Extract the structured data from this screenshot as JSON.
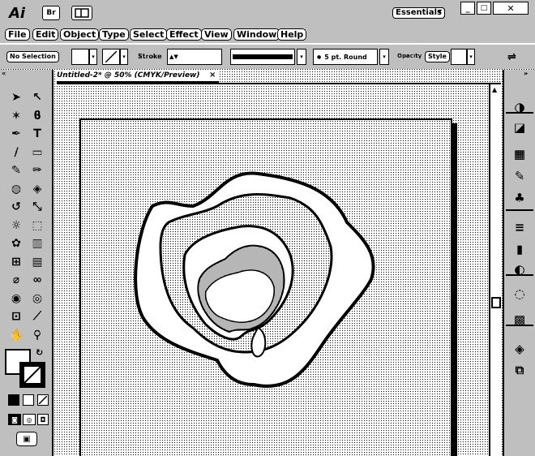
{
  "app": {
    "logo": "Ai",
    "bridge_label": "Br",
    "arrange_icon": "arrange-documents-icon"
  },
  "workspace": {
    "label": "Essentials"
  },
  "window_controls": {
    "minimize": "minimize-icon",
    "restore": "restore-icon",
    "close": "close-icon"
  },
  "menu": [
    "File",
    "Edit",
    "Object",
    "Type",
    "Select",
    "Effect",
    "View",
    "Window",
    "Help"
  ],
  "control": {
    "selection_label": "No Selection",
    "stroke_label": "Stroke",
    "brush_value": "5 pt. Round",
    "opacity_label": "Opacity",
    "style_label": "Style"
  },
  "document": {
    "tab_title": "Untitled-2* @ 50% (CMYK/Preview)",
    "tab_close": "×"
  },
  "tools": [
    "selection-tool-icon",
    "direct-selection-tool-icon",
    "magic-wand-tool-icon",
    "lasso-tool-icon",
    "pen-tool-icon",
    "type-tool-icon",
    "line-tool-icon",
    "rectangle-tool-icon",
    "paintbrush-tool-icon",
    "pencil-tool-icon",
    "blob-brush-tool-icon",
    "eraser-tool-icon",
    "rotate-tool-icon",
    "scale-tool-icon",
    "warp-tool-icon",
    "free-transform-tool-icon",
    "symbol-sprayer-tool-icon",
    "graph-tool-icon",
    "mesh-tool-icon",
    "gradient-tool-icon",
    "eyedropper-tool-icon",
    "blend-tool-icon",
    "live-paint-tool-icon",
    "live-paint-selection-tool-icon",
    "artboard-tool-icon",
    "slice-tool-icon",
    "hand-tool-icon",
    "zoom-tool-icon"
  ],
  "panels": [
    "color-panel-icon",
    "color-guide-panel-icon",
    "swatches-panel-icon",
    "brushes-panel-icon",
    "symbols-panel-icon",
    "stroke-panel-icon",
    "gradient-panel-icon",
    "transparency-panel-icon",
    "appearance-panel-icon",
    "graphic-styles-panel-icon",
    "layers-panel-icon",
    "artboards-panel-icon"
  ]
}
